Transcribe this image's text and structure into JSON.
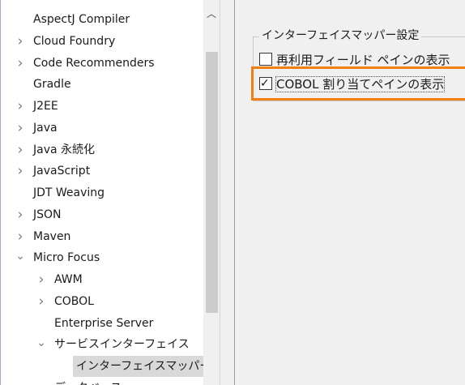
{
  "tree": {
    "items": [
      {
        "label": "AspectJ Compiler",
        "chevron": "none"
      },
      {
        "label": "Cloud Foundry",
        "chevron": "right"
      },
      {
        "label": "Code Recommenders",
        "chevron": "right"
      },
      {
        "label": "Gradle",
        "chevron": "none"
      },
      {
        "label": "J2EE",
        "chevron": "right"
      },
      {
        "label": "Java",
        "chevron": "right"
      },
      {
        "label": "Java 永続化",
        "chevron": "right"
      },
      {
        "label": "JavaScript",
        "chevron": "right"
      },
      {
        "label": "JDT Weaving",
        "chevron": "none"
      },
      {
        "label": "JSON",
        "chevron": "right"
      },
      {
        "label": "Maven",
        "chevron": "right"
      },
      {
        "label": "Micro Focus",
        "chevron": "down"
      },
      {
        "label": "AWM",
        "chevron": "right"
      },
      {
        "label": "COBOL",
        "chevron": "right"
      },
      {
        "label": "Enterprise Server",
        "chevron": "none"
      },
      {
        "label": "サービスインターフェイス",
        "chevron": "down"
      },
      {
        "label": "インターフェイスマッパー",
        "chevron": "none",
        "selected": true
      },
      {
        "label": "データベース",
        "chevron": "right"
      }
    ]
  },
  "settings": {
    "group_title": "インターフェイスマッパー設定",
    "options": [
      {
        "label": "再利用フィールド ペインの表示",
        "checked": false
      },
      {
        "label": "COBOL 割り当てペインの表示",
        "checked": true
      }
    ]
  },
  "colors": {
    "highlight": "#f07f14",
    "selection": "#d9d9d9",
    "panel_bg": "#f0f0f0"
  }
}
